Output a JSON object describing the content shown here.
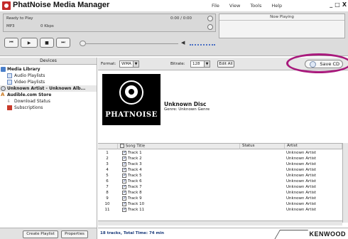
{
  "app": {
    "title": "PhatNoise Media Manager",
    "menu": [
      "File",
      "View",
      "Tools",
      "Help"
    ],
    "window_controls": [
      "_",
      "□",
      "X"
    ]
  },
  "player": {
    "status": "Ready to Play",
    "format": "MP3",
    "bitrate": "0 Kbps",
    "time": "0:00 / 0:00",
    "now_playing_label": "Now Playing",
    "transport_icons": [
      "previous-icon",
      "play-icon",
      "stop-icon",
      "next-icon"
    ],
    "seek_position": 0,
    "volume_icon": "speaker-icon"
  },
  "sidebar": {
    "header": "Devices",
    "items": [
      {
        "label": "Media Library",
        "bold": true,
        "icon": "library-icon"
      },
      {
        "label": "Audio Playlists",
        "bold": false,
        "icon": "playlist-icon"
      },
      {
        "label": "Video Playlists",
        "bold": false,
        "icon": "playlist-icon"
      },
      {
        "label": "Unknown Artist - Unknown Alb...",
        "bold": true,
        "icon": "disc-icon",
        "selected": true
      },
      {
        "label": "Audible.com Store",
        "bold": true,
        "icon": "audible-icon"
      },
      {
        "label": "Download Status",
        "bold": false,
        "icon": "download-icon"
      },
      {
        "label": "Subscriptions",
        "bold": false,
        "icon": "subscriptions-icon"
      }
    ],
    "buttons": {
      "create_playlist": "Create Playlist",
      "properties": "Properties"
    }
  },
  "toolbar": {
    "format_label": "Format:",
    "format_value": "WMA",
    "bitrate_label": "Bitrate:",
    "bitrate_value": "128",
    "edit_all": "Edit All",
    "save_cd": "Save CD"
  },
  "album": {
    "brand": "PHATNOISE",
    "title": "Unknown Disc",
    "genre": "Genre: Unknown Genre"
  },
  "tracklist": {
    "columns": [
      "Song Title",
      "Status",
      "Artist"
    ],
    "rows": [
      {
        "num": "1",
        "title": "Track 1",
        "status": "",
        "artist": "Unknown Artist"
      },
      {
        "num": "2",
        "title": "Track 2",
        "status": "",
        "artist": "Unknown Artist"
      },
      {
        "num": "3",
        "title": "Track 3",
        "status": "",
        "artist": "Unknown Artist"
      },
      {
        "num": "4",
        "title": "Track 4",
        "status": "",
        "artist": "Unknown Artist"
      },
      {
        "num": "5",
        "title": "Track 5",
        "status": "",
        "artist": "Unknown Artist"
      },
      {
        "num": "6",
        "title": "Track 6",
        "status": "",
        "artist": "Unknown Artist"
      },
      {
        "num": "7",
        "title": "Track 7",
        "status": "",
        "artist": "Unknown Artist"
      },
      {
        "num": "8",
        "title": "Track 8",
        "status": "",
        "artist": "Unknown Artist"
      },
      {
        "num": "9",
        "title": "Track 9",
        "status": "",
        "artist": "Unknown Artist"
      },
      {
        "num": "10",
        "title": "Track 10",
        "status": "",
        "artist": "Unknown Artist"
      },
      {
        "num": "11",
        "title": "Track 11",
        "status": "",
        "artist": "Unknown Artist"
      }
    ]
  },
  "status": {
    "summary": "18 tracks, Total Time: 74 min",
    "brand": "KENWOOD"
  },
  "colors": {
    "highlight_ring": "#a8197c",
    "status_text": "#1a3a7a",
    "chrome": "#dcdcdc"
  }
}
